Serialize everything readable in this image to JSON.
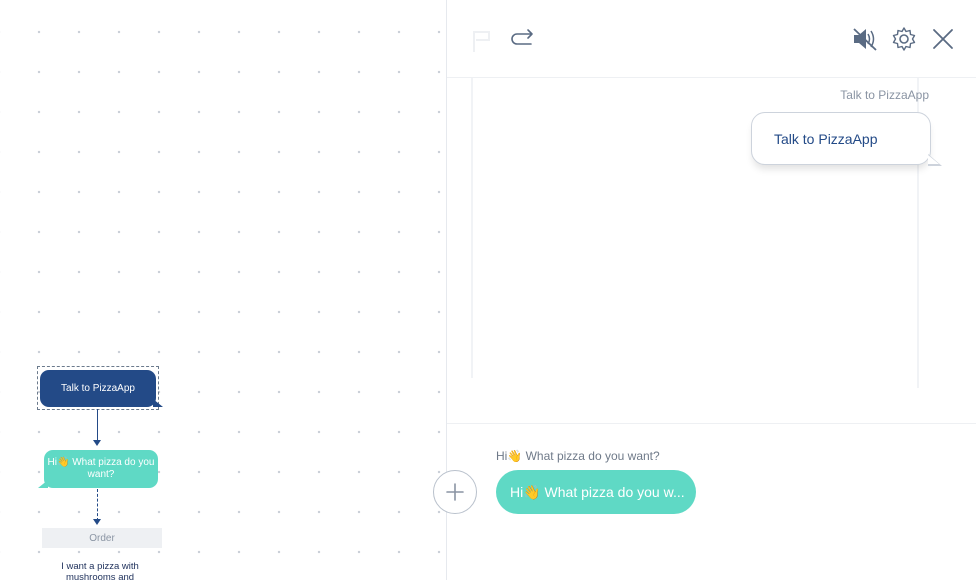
{
  "canvas": {
    "user_node_label": "Talk to PizzaApp",
    "bot_node_label": "Hi👋 What pizza do you want?",
    "order_label": "Order",
    "next_node_text": "I want a pizza with mushrooms and"
  },
  "chat": {
    "toolbar": {
      "undo_icon": "flag-icon",
      "redo_icon": "redo-icon",
      "mute_icon": "speaker-muted-icon",
      "settings_icon": "gear-icon",
      "close_icon": "close-icon"
    },
    "messages": [
      {
        "sender": "Talk to PizzaApp",
        "text": "Talk to PizzaApp"
      }
    ],
    "composer": {
      "suggestion_label": "Hi👋  What pizza do you want?",
      "suggestion_bubble": "Hi👋  What pizza do you w..."
    }
  },
  "colors": {
    "navy": "#234a87",
    "teal": "#5fd9c5",
    "muted_text": "#8a94a3"
  }
}
